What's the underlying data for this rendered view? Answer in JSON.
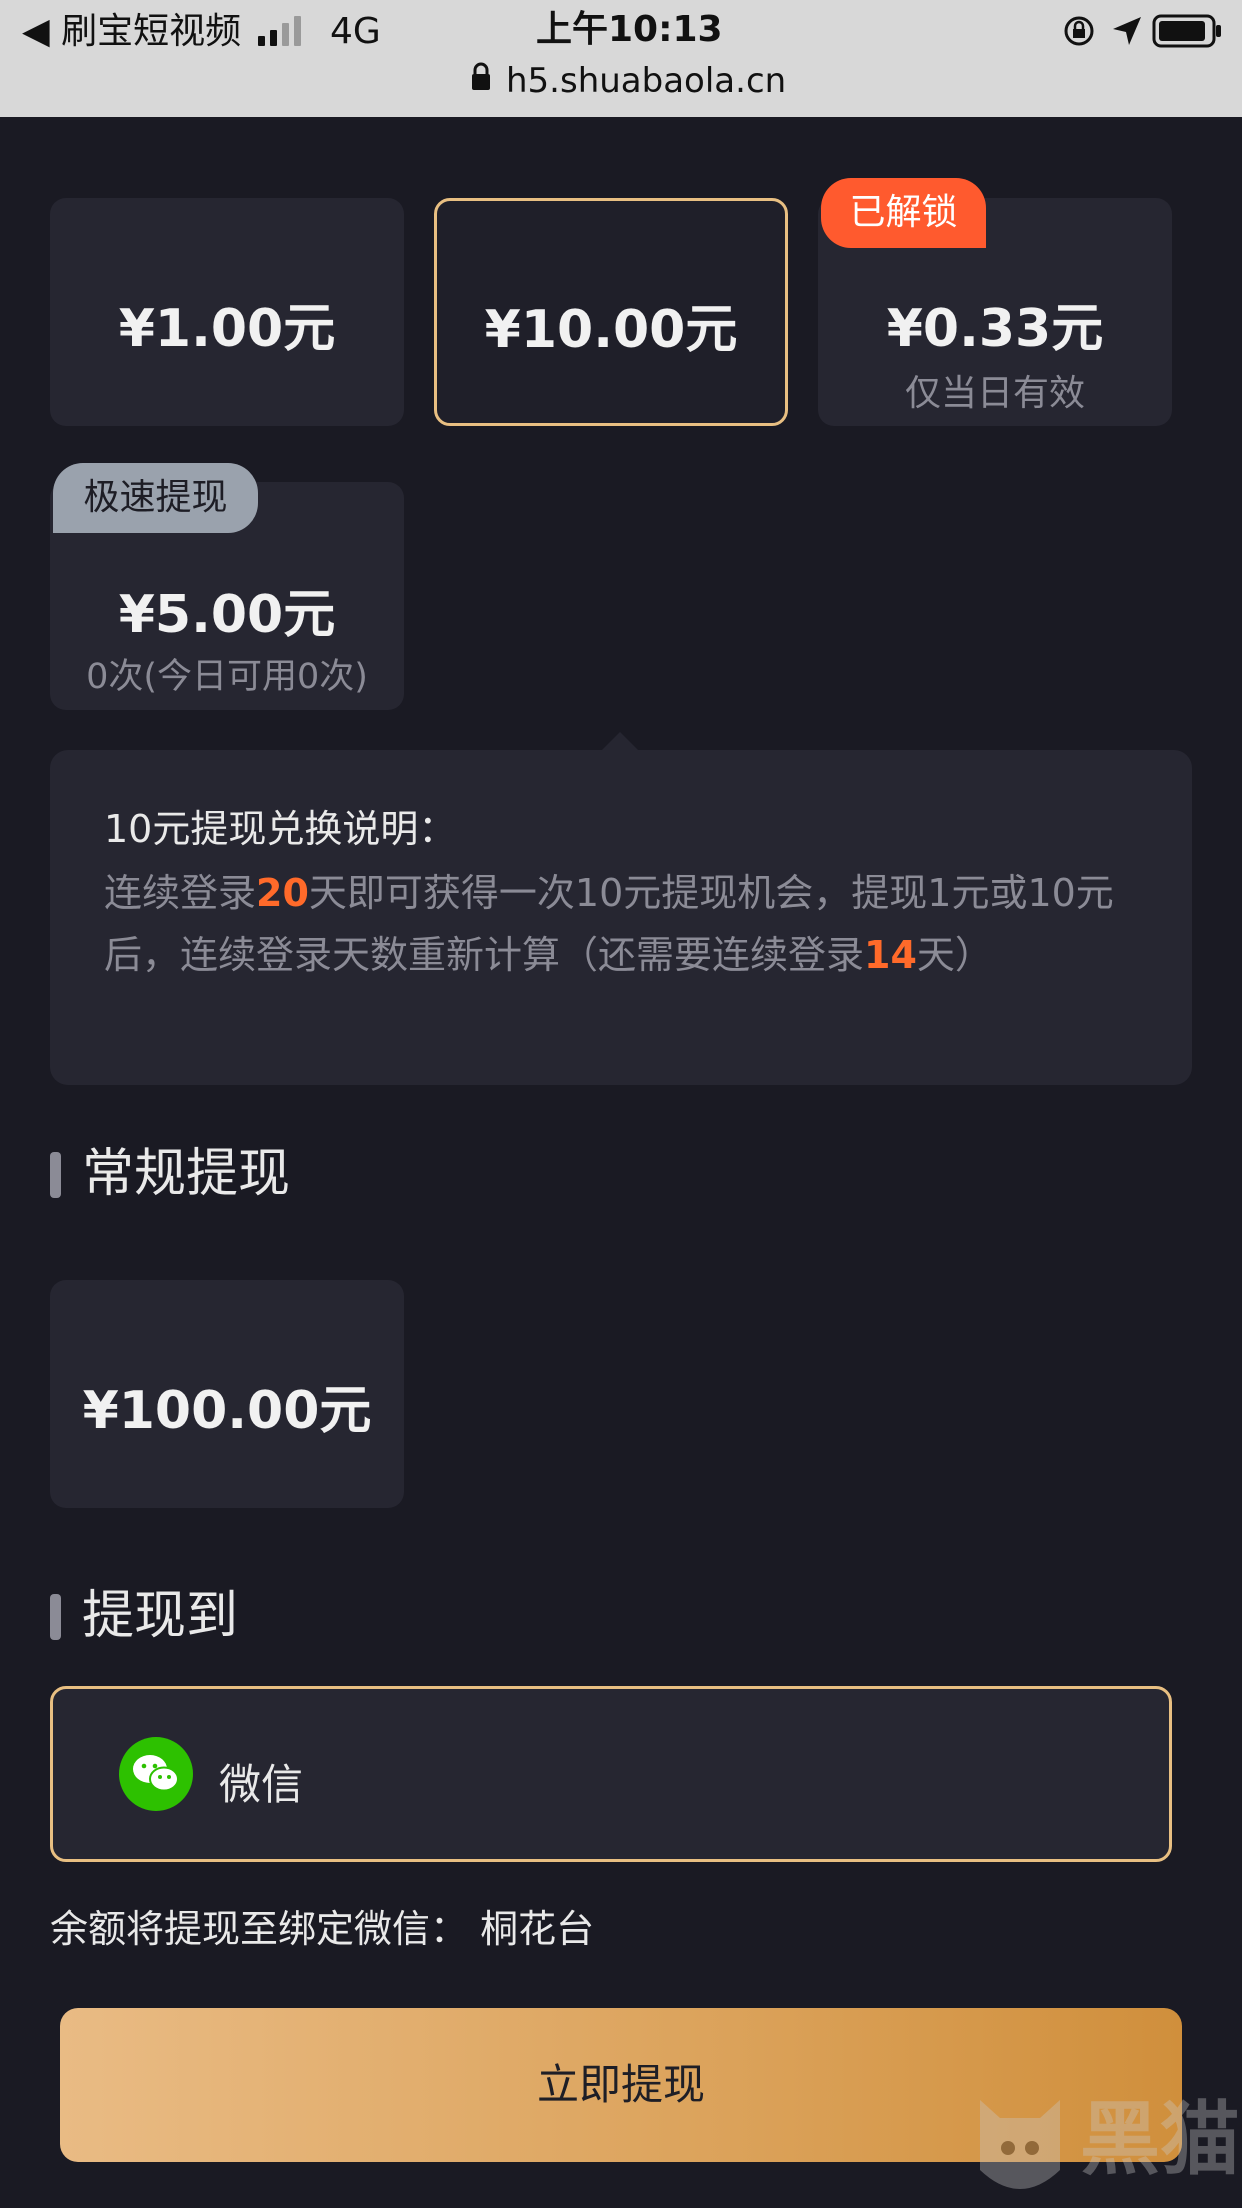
{
  "status_bar": {
    "back_label": "◀ 刷宝短视频",
    "network": "4G",
    "time": "上午10:13",
    "url": "h5.shuabaola.cn"
  },
  "amount_cards": [
    {
      "amount": "¥1.00元",
      "sub": "",
      "tag": ""
    },
    {
      "amount": "¥10.00元",
      "sub": "",
      "tag": ""
    },
    {
      "amount": "¥0.33元",
      "sub": "仅当日有效",
      "tag": "已解锁"
    },
    {
      "amount": "¥5.00元",
      "sub": "0次(今日可用0次)",
      "tag": "极速提现"
    }
  ],
  "info": {
    "title": "10元提现兑换说明：",
    "desc_1": "连续登录",
    "days_required": "20",
    "desc_2": "天即可获得一次10元提现机会，提现1元或10元后，连续登录天数重新计算（还需要连续登录",
    "days_remaining": "14",
    "desc_3": "天）"
  },
  "regular": {
    "title": "常规提现",
    "amount": "¥100.00元"
  },
  "withdraw_to": {
    "title": "提现到",
    "method": "微信"
  },
  "note": "余额将提现至绑定微信： 桐花台",
  "cta_label": "立即提现",
  "watermark_text": "黑猫",
  "colors": {
    "background": "#1a1a23",
    "card": "#262631",
    "gold_border": "#e8bf82",
    "orange_tag": "#ff5a2e",
    "highlight": "#ff6a2a",
    "wechat_green": "#2dc100"
  }
}
